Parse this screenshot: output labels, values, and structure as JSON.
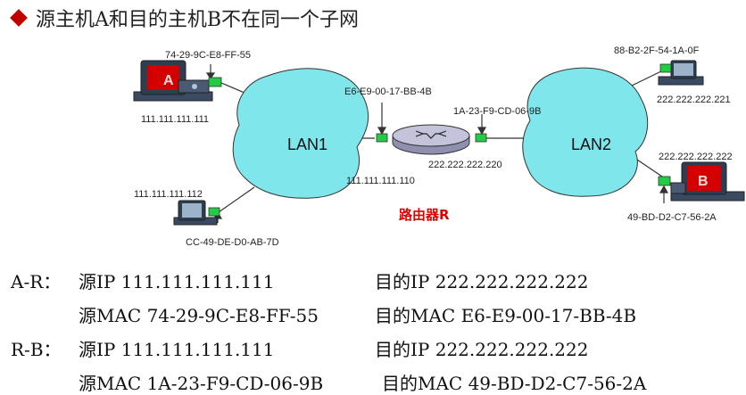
{
  "title": "源主机A和目的主机B不在同一个子网",
  "diagram": {
    "hostA": {
      "letter": "A",
      "mac": "74-29-9C-E8-FF-55",
      "ip": "111.111.111.111"
    },
    "hostC": {
      "mac": "CC-49-DE-D0-AB-7D",
      "ip": "111.111.111.112"
    },
    "hostD": {
      "mac": "88-B2-2F-54-1A-0F",
      "ip": "222.222.222.221"
    },
    "hostB": {
      "letter": "B",
      "mac": "49-BD-D2-C7-56-2A",
      "ip": "222.222.222.222"
    },
    "lan1": "LAN1",
    "lan2": "LAN2",
    "router": {
      "name": "路由器R",
      "left_mac": "E6-E9-00-17-BB-4B",
      "left_ip": "111.111.111.110",
      "right_mac": "1A-23-F9-CD-06-9B",
      "right_ip": "222.222.222.220"
    }
  },
  "table": {
    "ar": {
      "label": "A-R：",
      "src_ip": "源IP 111.111.111.111",
      "dst_ip": "目的IP 222.222.222.222",
      "src_mac": "源MAC 74-29-9C-E8-FF-55",
      "dst_mac": "目的MAC E6-E9-00-17-BB-4B"
    },
    "rb": {
      "label": "R-B：",
      "src_ip": "源IP 111.111.111.111",
      "dst_ip": "目的IP 222.222.222.222",
      "src_mac": "源MAC 1A-23-F9-CD-06-9B",
      "dst_mac": "目的MAC 49-BD-D2-C7-56-2A"
    }
  },
  "colors": {
    "bullet": "#c00000",
    "lan_fill": "#7fe6ec",
    "router_label": "#e00000",
    "adapter": "#22cc44"
  }
}
